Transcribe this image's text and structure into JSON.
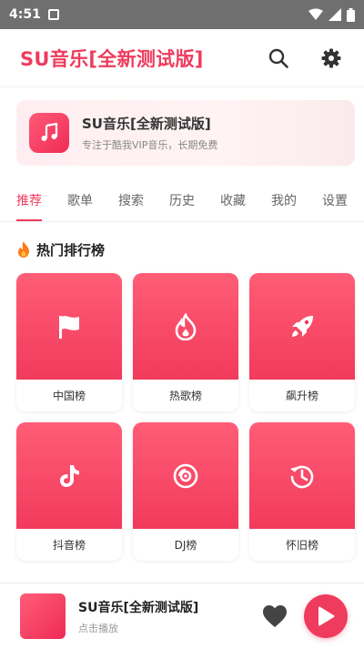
{
  "status_bar": {
    "time": "4:51"
  },
  "app": {
    "title": "SU音乐[全新测试版]"
  },
  "banner": {
    "title": "SU音乐[全新测试版]",
    "subtitle": "专注于酷我VIP音乐，长期免费"
  },
  "tabs": [
    {
      "label": "推荐",
      "active": true
    },
    {
      "label": "歌单"
    },
    {
      "label": "搜索"
    },
    {
      "label": "历史"
    },
    {
      "label": "收藏"
    },
    {
      "label": "我的"
    },
    {
      "label": "设置"
    }
  ],
  "section": {
    "title": "热门排行榜",
    "icon": "fire-icon"
  },
  "charts": [
    {
      "label": "中国榜",
      "icon": "flag-icon"
    },
    {
      "label": "热歌榜",
      "icon": "fire-icon"
    },
    {
      "label": "飙升榜",
      "icon": "rocket-icon"
    },
    {
      "label": "抖音榜",
      "icon": "tiktok-icon"
    },
    {
      "label": "DJ榜",
      "icon": "disc-icon"
    },
    {
      "label": "怀旧榜",
      "icon": "history-icon"
    }
  ],
  "player": {
    "title": "SU音乐[全新测试版]",
    "subtitle": "点击播放"
  },
  "colors": {
    "accent": "#ef3b5d",
    "status_bar": "#6f6f6f"
  }
}
